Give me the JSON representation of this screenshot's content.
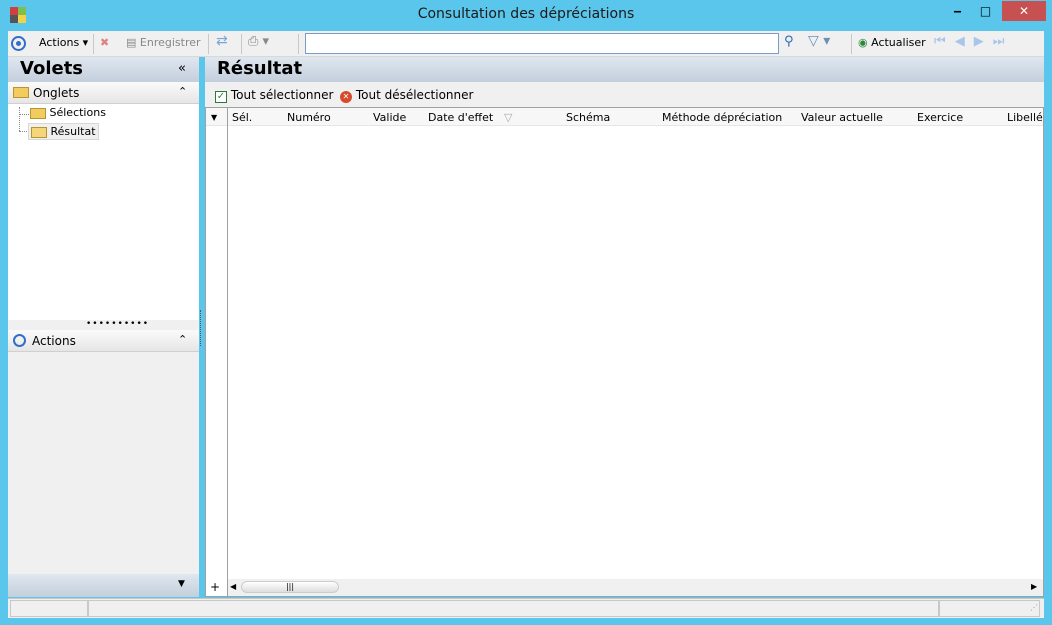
{
  "window": {
    "title": "Consultation des dépréciations",
    "minimize": "‒",
    "maximize": "□",
    "close": "✕"
  },
  "toolbar": {
    "actions": "Actions",
    "save": "Enregistrer",
    "search_value": "",
    "refresh": "Actualiser"
  },
  "left": {
    "title": "Volets",
    "collapse": "«",
    "sections": {
      "tabs": "Onglets",
      "actions": "Actions"
    },
    "tree": [
      {
        "label": "Sélections",
        "icon": "folder-icon"
      },
      {
        "label": "Résultat",
        "icon": "folder-open-icon",
        "selected": true
      }
    ]
  },
  "main": {
    "title": "Résultat",
    "select_all": "Tout sélectionner",
    "deselect_all": "Tout désélectionner",
    "columns": [
      "Sél.",
      "Numéro",
      "Valide",
      "Date d'effet",
      "Schéma",
      "Méthode dépréciation",
      "Valeur actuelle",
      "Exercice",
      "Libellé"
    ],
    "rows": []
  }
}
